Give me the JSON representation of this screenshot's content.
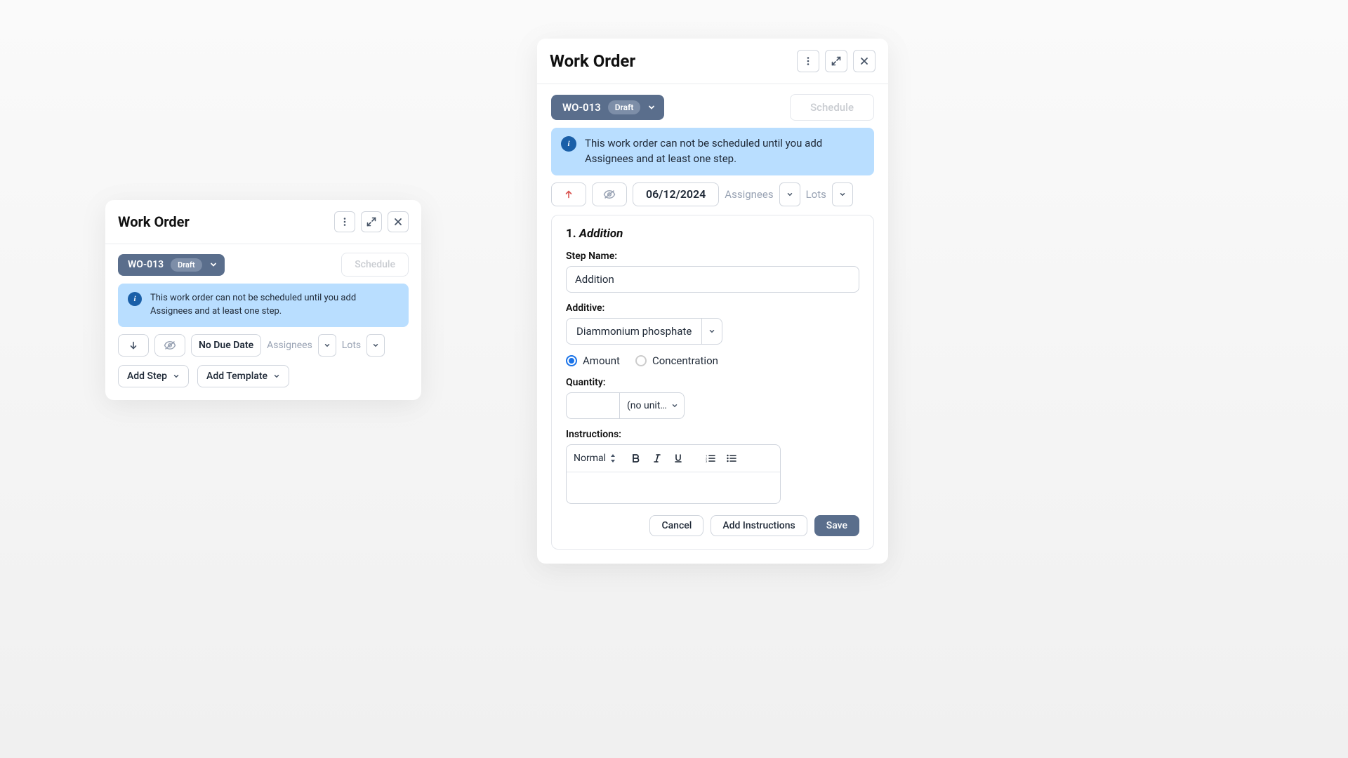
{
  "small": {
    "title": "Work Order",
    "wo_number": "WO-013",
    "status_badge": "Draft",
    "schedule_label": "Schedule",
    "info_text": "This work order can not be scheduled until you add Assignees and at least one step.",
    "due_date": "No Due Date",
    "assignees_label": "Assignees",
    "lots_label": "Lots",
    "add_step_label": "Add Step",
    "add_template_label": "Add Template"
  },
  "large": {
    "title": "Work Order",
    "wo_number": "WO-013",
    "status_badge": "Draft",
    "schedule_label": "Schedule",
    "info_text": "This work order can not be scheduled until you add Assignees and at least one step.",
    "due_date": "06/12/2024",
    "assignees_label": "Assignees",
    "lots_label": "Lots",
    "step": {
      "heading_number": "1.",
      "heading_name": "Addition",
      "name_label": "Step Name:",
      "name_value": "Addition",
      "additive_label": "Additive:",
      "additive_value": "Diammonium phosphate",
      "radio_amount": "Amount",
      "radio_concentration": "Concentration",
      "quantity_label": "Quantity:",
      "quantity_value": "",
      "unit_value": "(no unit…",
      "instructions_label": "Instructions:",
      "format_value": "Normal",
      "cancel_label": "Cancel",
      "add_instructions_label": "Add Instructions",
      "save_label": "Save"
    }
  }
}
